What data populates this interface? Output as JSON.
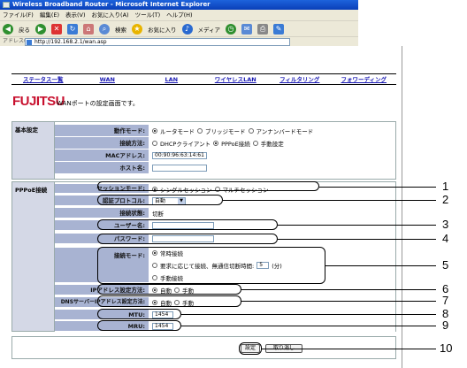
{
  "window": {
    "title": "Wireless Broadband Router - Microsoft Internet Explorer"
  },
  "menu": [
    "ファイル(F)",
    "編集(E)",
    "表示(V)",
    "お気に入り(A)",
    "ツール(T)",
    "ヘルプ(H)"
  ],
  "toolbar": {
    "back": "戻る",
    "search": "検索",
    "favorites": "お気に入り",
    "media": "メディア"
  },
  "address": {
    "label": "アドレス(D)",
    "url": "http://192.168.2.1/wan.asp"
  },
  "nav": [
    "ステータス一覧",
    "WAN",
    "LAN",
    "ワイヤレスLAN",
    "フィルタリング",
    "フォワーディング"
  ],
  "logo": "FUJITSU",
  "page_title": "WANポートの設定画面です。",
  "basic": {
    "header": "基本設定",
    "mode_label": "動作モード:",
    "modes": [
      "ルータモード",
      "ブリッジモード",
      "アンナンバードモード"
    ],
    "method_label": "接続方法:",
    "methods": [
      "DHCPクライアント",
      "PPPoE接続",
      "手動設定"
    ],
    "mac_label": "MACアドレス:",
    "mac_value": "00:90:96:63:14:61",
    "host_label": "ホスト名:",
    "host_value": ""
  },
  "pppoe": {
    "header": "PPPoE接続",
    "session_label": "セッションモード:",
    "session_opts": [
      "シングルセッション",
      "マルチセッション"
    ],
    "auth_label": "認証プロトコル:",
    "auth_value": "自動",
    "status_label": "接続状態:",
    "status_value": "切断",
    "user_label": "ユーザー名:",
    "user_value": "",
    "pass_label": "パスワード:",
    "pass_value": "",
    "conn_label": "接続モード:",
    "conn_opts": [
      "常時接続",
      "要求に応じて接続、無通信切断時間:",
      "手動接続"
    ],
    "idle_value": "5",
    "idle_unit": "(分)",
    "ip_label": "IPアドレス設定方法:",
    "ip_opts": [
      "自動",
      "手動"
    ],
    "dns_label": "DNSサーバーIPアドレス設定方法:",
    "dns_opts": [
      "自動",
      "手動"
    ],
    "mtu_label": "MTU:",
    "mtu_value": "1454",
    "mru_label": "MRU:",
    "mru_value": "1454"
  },
  "buttons": {
    "apply": "設定",
    "cancel": "取り消し"
  },
  "callouts": [
    "1",
    "2",
    "3",
    "4",
    "5",
    "6",
    "7",
    "8",
    "9",
    "10"
  ]
}
